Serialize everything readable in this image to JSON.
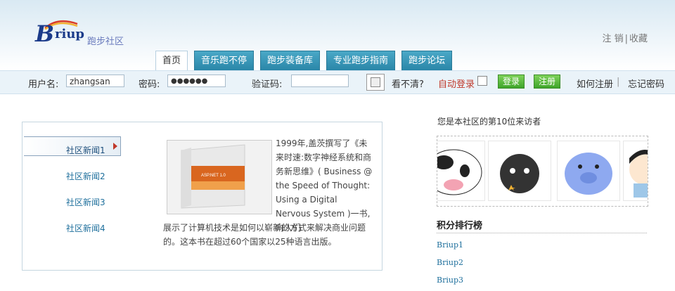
{
  "logo": {
    "mark": "B",
    "word": "riup",
    "cn": "跑步社区"
  },
  "toplinks": {
    "logout": "注 销",
    "sep": "|",
    "favorite": "收藏"
  },
  "tabs": [
    {
      "label": "首页",
      "active": true
    },
    {
      "label": "音乐跑不停"
    },
    {
      "label": "跑步装备库"
    },
    {
      "label": "专业跑步指南"
    },
    {
      "label": "跑步论坛"
    }
  ],
  "login": {
    "username_label": "用户名:",
    "username_value": "zhangsan",
    "password_label": "密码:",
    "password_value": "●●●●●●",
    "captcha_label": "验证码:",
    "captcha_value": "",
    "cant_see": "看不清?",
    "auto_login": "自动登录",
    "login_button": "登录",
    "register_button": "注册",
    "how_register": "如何注册",
    "sep": "|",
    "forgot": "忘记密码"
  },
  "news": {
    "items": [
      "社区新闻1",
      "社区新闻2",
      "社区新闻3",
      "社区新闻4"
    ],
    "desc_top": "1999年,盖茨撰写了《未来时速:数字神经系统和商务新思维》( Business @ the Speed of Thought: Using a Digital Nervous System )一书, 向人们",
    "desc_bottom": "展示了计算机技术是如何以崭新的方式来解决商业问题的。这本书在超过60个国家以25种语言出版。",
    "product_label": "ASP.NET 1.0"
  },
  "sidebar": {
    "visitor": "您是本社区的第10位来访者",
    "rank_title": "积分排行榜",
    "rank": [
      "Briup1",
      "Briup2",
      "Briup3"
    ]
  },
  "colors": {
    "tab": "#2a86a8",
    "accent": "#1e6f9c",
    "green": "#3fa52a",
    "red": "#c0392b"
  }
}
